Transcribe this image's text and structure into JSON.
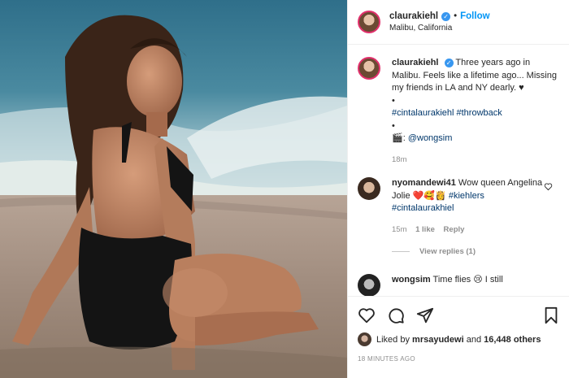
{
  "header": {
    "username": "claurakiehl",
    "verified_mark": "✓",
    "separator": "•",
    "follow_label": "Follow",
    "location": "Malibu, California"
  },
  "caption": {
    "username": "claurakiehl",
    "verified_mark": "✓",
    "text": "Three years ago in Malibu. Feels like a lifetime ago... Missing my friends in LA and NY dearly. ♥",
    "bullet1": "•",
    "hashtag1": "#cintalaurakiehl",
    "hashtag2": "#throwback",
    "bullet2": "•",
    "camera_emoji": "🎬",
    "credit_prefix": ": ",
    "credit_handle": "@wongsim",
    "age": "18m"
  },
  "comments": [
    {
      "username": "nyomandewi41",
      "text": "Wow queen Angelina Jolie ❤️🥰👸",
      "tag1": "#kiehlers",
      "tag2": "#cintalaurakhiel",
      "age": "15m",
      "likes": "1 like",
      "reply_label": "Reply",
      "view_replies": "View replies (1)"
    },
    {
      "username": "wongsim",
      "text": "Time flies 😢 I still"
    }
  ],
  "actions": {
    "liked_prefix": "Liked by",
    "liked_user": "mrsayudewi",
    "liked_and": "and",
    "liked_count": "16,448 others",
    "timestamp": "18 MINUTES AGO"
  },
  "colors": {
    "accent": "#0095f6",
    "verified": "#3897f0",
    "hashtag": "#00376b",
    "muted": "#8e8e8e"
  },
  "icons": [
    "heart-icon",
    "comment-icon",
    "share-icon",
    "bookmark-icon",
    "verified-icon",
    "like-comment-icon"
  ]
}
